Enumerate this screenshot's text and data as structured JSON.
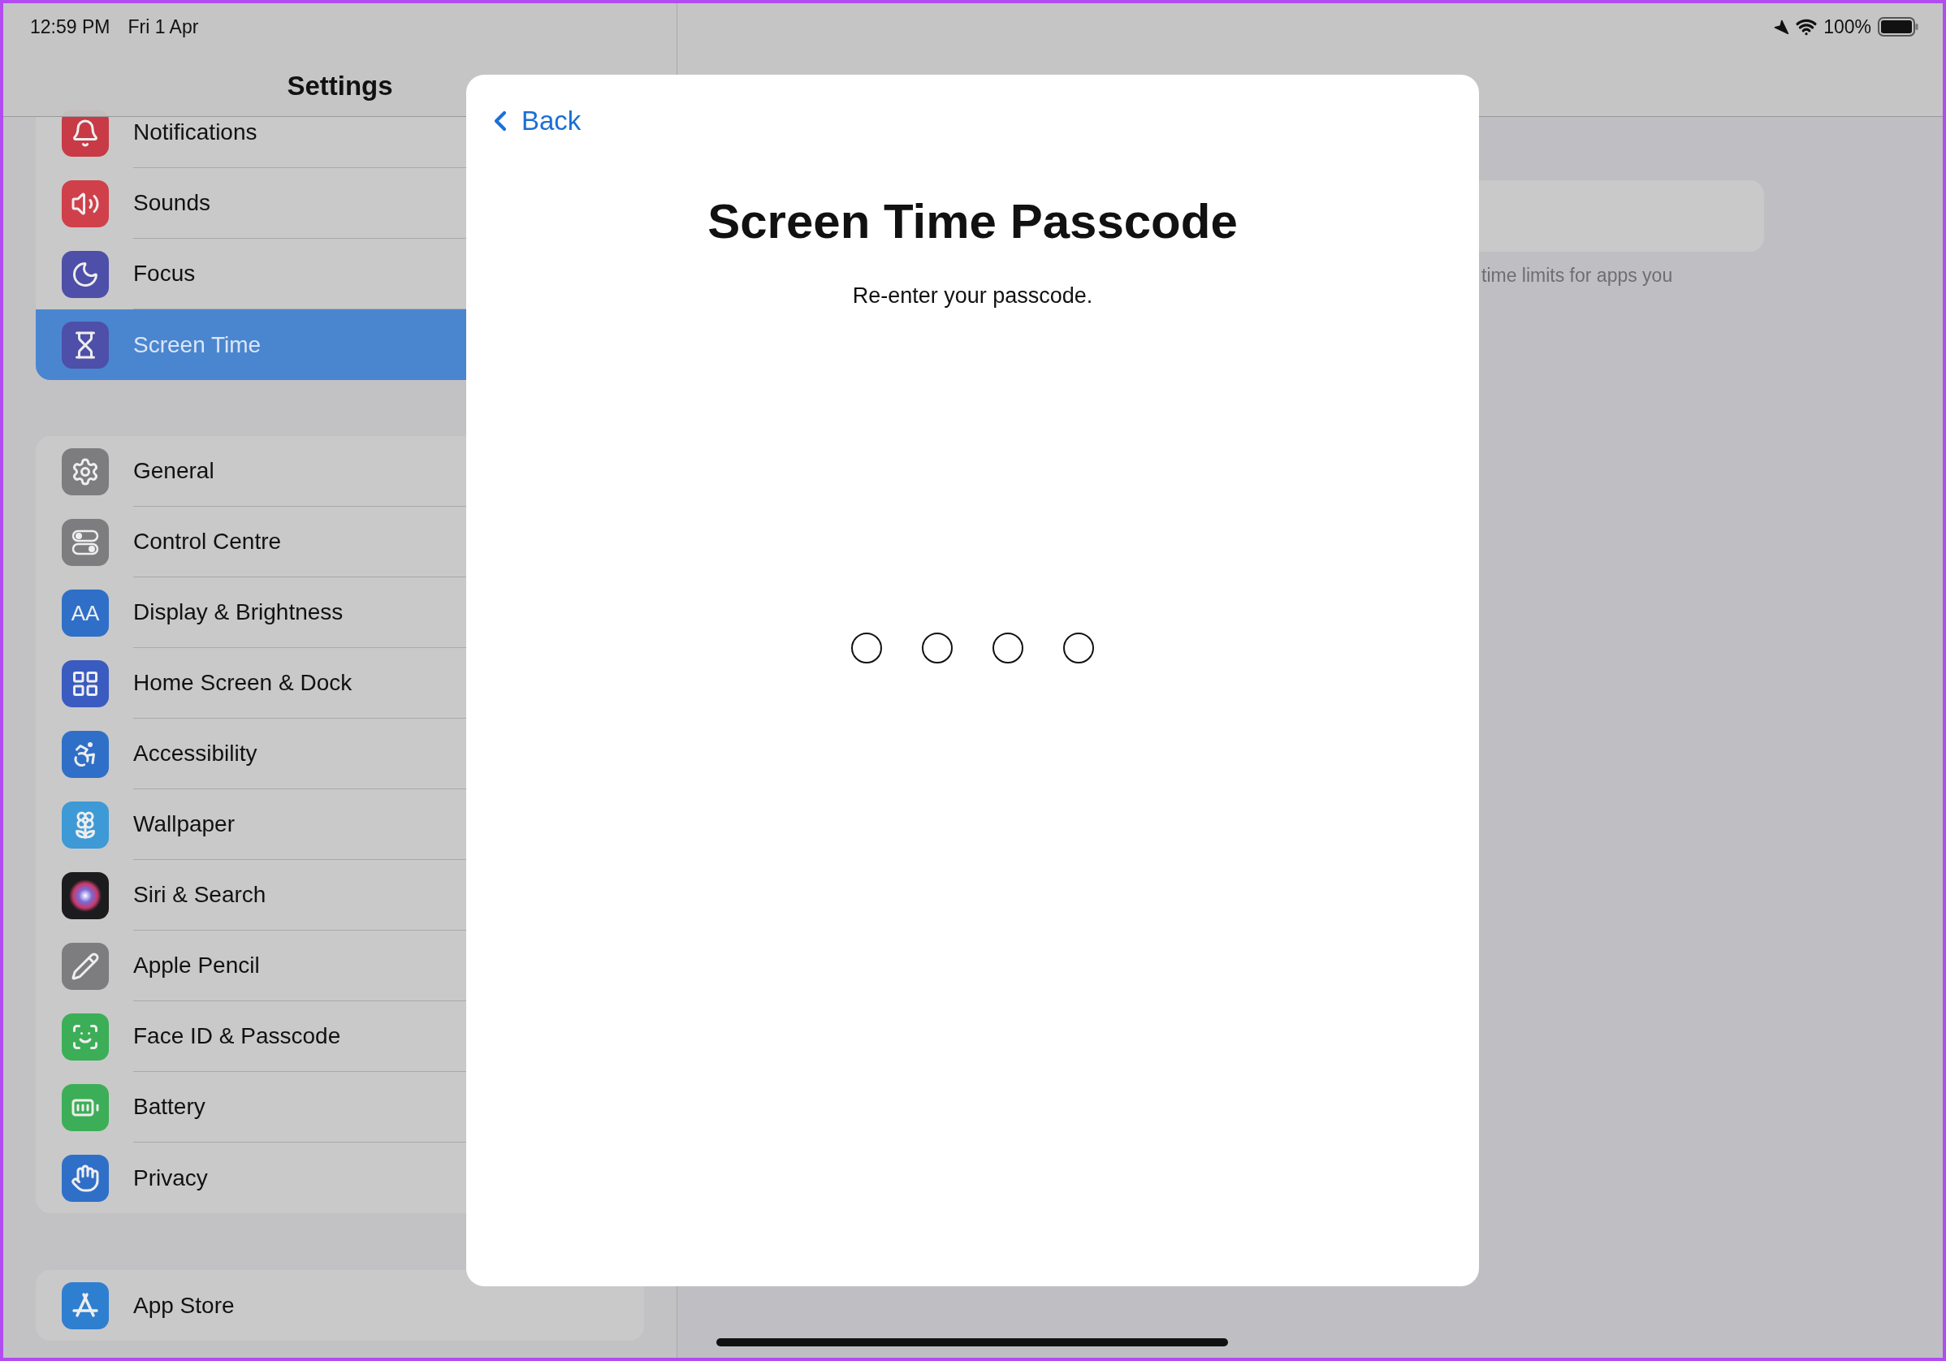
{
  "status_bar": {
    "time": "12:59 PM",
    "date": "Fri 1 Apr",
    "battery": "100%"
  },
  "sidebar": {
    "title": "Settings",
    "groups": [
      {
        "items": [
          {
            "label": "Notifications",
            "selected": false
          },
          {
            "label": "Sounds",
            "selected": false
          },
          {
            "label": "Focus",
            "selected": false
          },
          {
            "label": "Screen Time",
            "selected": true
          }
        ]
      },
      {
        "items": [
          {
            "label": "General",
            "selected": false
          },
          {
            "label": "Control Centre",
            "selected": false
          },
          {
            "label": "Display & Brightness",
            "selected": false,
            "icon_text": "AA"
          },
          {
            "label": "Home Screen & Dock",
            "selected": false
          },
          {
            "label": "Accessibility",
            "selected": false
          },
          {
            "label": "Wallpaper",
            "selected": false
          },
          {
            "label": "Siri & Search",
            "selected": false
          },
          {
            "label": "Apple Pencil",
            "selected": false
          },
          {
            "label": "Face ID & Passcode",
            "selected": false
          },
          {
            "label": "Battery",
            "selected": false
          },
          {
            "label": "Privacy",
            "selected": false
          }
        ]
      },
      {
        "items": [
          {
            "label": "App Store",
            "selected": false
          }
        ]
      }
    ]
  },
  "detail": {
    "footer_text": "time limits for apps you"
  },
  "modal": {
    "back": "Back",
    "title": "Screen Time Passcode",
    "subtitle": "Re-enter your passcode.",
    "digits": [
      {
        "filled": false
      },
      {
        "filled": false
      },
      {
        "filled": false
      },
      {
        "filled": false
      }
    ]
  }
}
